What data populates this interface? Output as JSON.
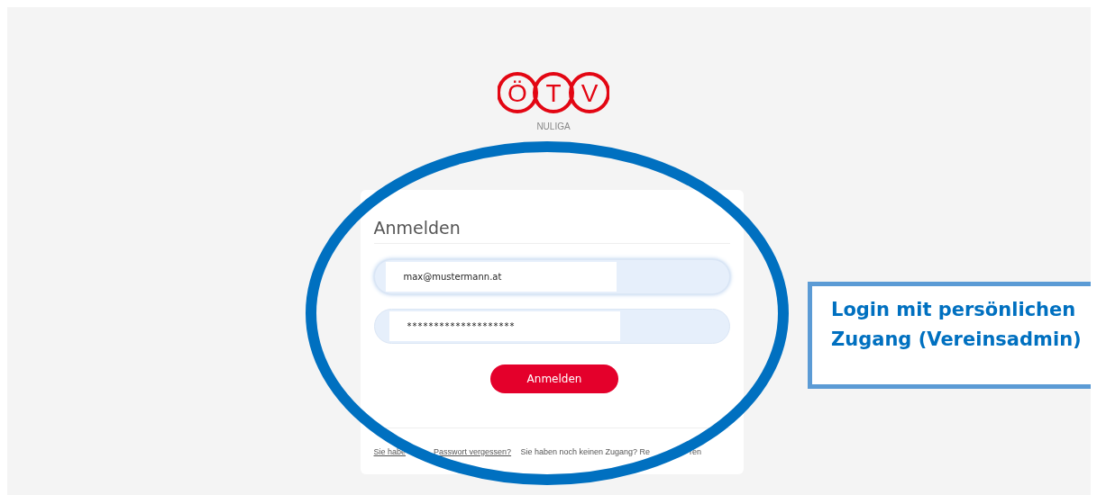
{
  "logo": {
    "letters": [
      "Ö",
      "T",
      "V"
    ],
    "caption": "NULIGA"
  },
  "login": {
    "title": "Anmelden",
    "fields": [
      {
        "kind": "text",
        "value": "max@mustermann.at",
        "focused": true
      },
      {
        "kind": "password",
        "value": "********************",
        "focused": false
      }
    ],
    "button": "Anmelden",
    "footer_links": [
      {
        "parts": [
          "Sie habe",
          "Passwort vergessen?"
        ],
        "underlined": true
      },
      {
        "parts": [
          "Sie haben noch keinen Zugang? Re",
          "ren"
        ],
        "underlined": false
      }
    ]
  },
  "callout": {
    "text": "Login mit persönlichen Zugang (Vereinsadmin)"
  }
}
